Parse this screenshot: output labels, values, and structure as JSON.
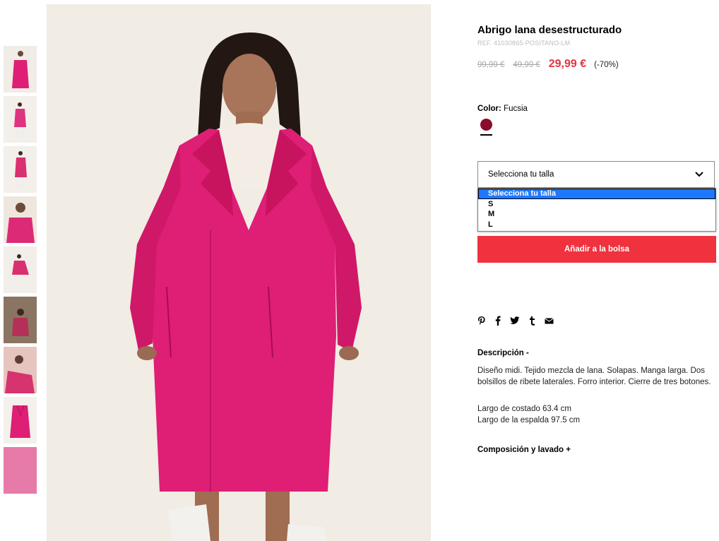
{
  "product": {
    "title": "Abrigo lana desestructurado",
    "ref": "REF. 41030865-POSITANO-LM",
    "prices": {
      "original": "99,99 €",
      "previous": "49,99 €",
      "current": "29,99 €",
      "discount": "(-70%)"
    }
  },
  "color": {
    "label": "Color:",
    "value": "Fucsia",
    "swatch_hex": "#8c0a2c"
  },
  "size": {
    "selected": "Selecciona tu talla",
    "options": [
      "Selecciona tu talla",
      "S",
      "M",
      "L"
    ]
  },
  "cart": {
    "add_label": "Añadir a la bolsa",
    "accent": "#f0323e"
  },
  "share": {
    "icons": [
      "pinterest-icon",
      "facebook-icon",
      "twitter-icon",
      "tumblr-icon",
      "email-icon"
    ]
  },
  "description": {
    "heading": "Descripción  -",
    "text": "Diseño midi. Tejido mezcla de lana. Solapas. Manga larga. Dos bolsillos de ribete laterales. Forro interior. Cierre de tres botones.",
    "measures": [
      "Largo de costado 63.4 cm",
      "Largo de la espalda 97.5 cm"
    ]
  },
  "composition": {
    "heading": "Composición y lavado  +"
  },
  "gallery": {
    "thumbnail_count": 9,
    "coat_color": "#de1f75"
  }
}
